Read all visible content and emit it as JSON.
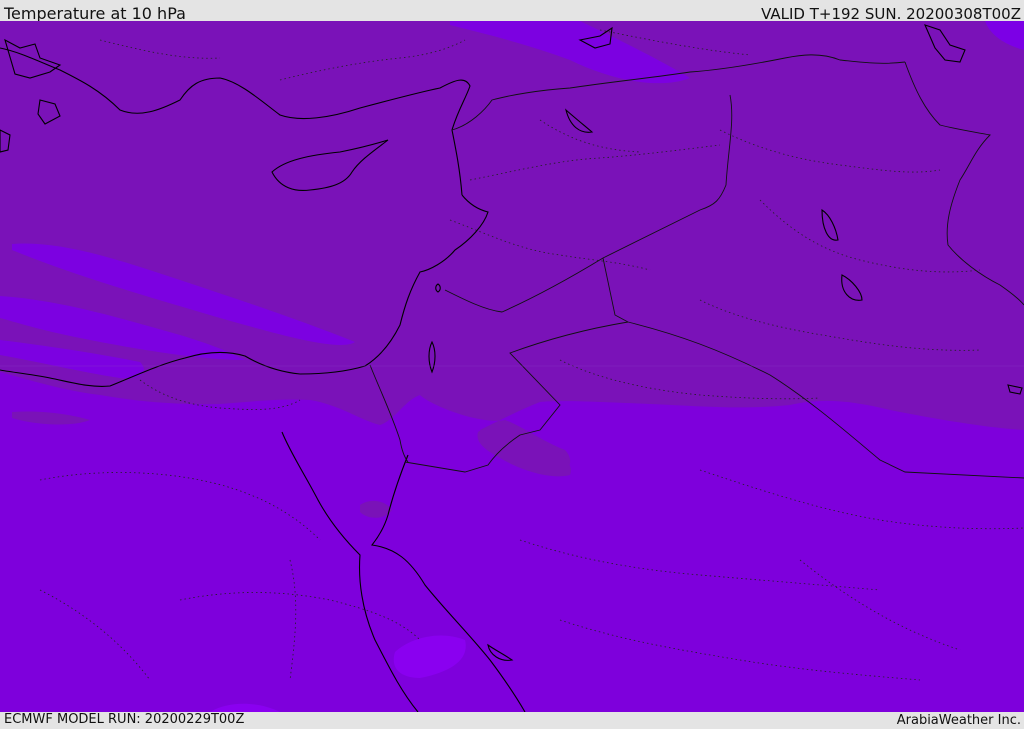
{
  "header": {
    "title": "Temperature at 10 hPa",
    "valid": "VALID T+192 SUN. 20200308T00Z"
  },
  "footer": {
    "model_run": "ECMWF MODEL RUN: 20200229T00Z",
    "credit": "ArabiaWeather Inc."
  },
  "map": {
    "region": "Eastern Mediterranean / Middle East",
    "colors": {
      "warm_band": "#7a12b8",
      "cool_band": "#7e00dc",
      "cold_patch": "#8a00f0",
      "coastline": "#000000",
      "border": "#111111"
    }
  }
}
